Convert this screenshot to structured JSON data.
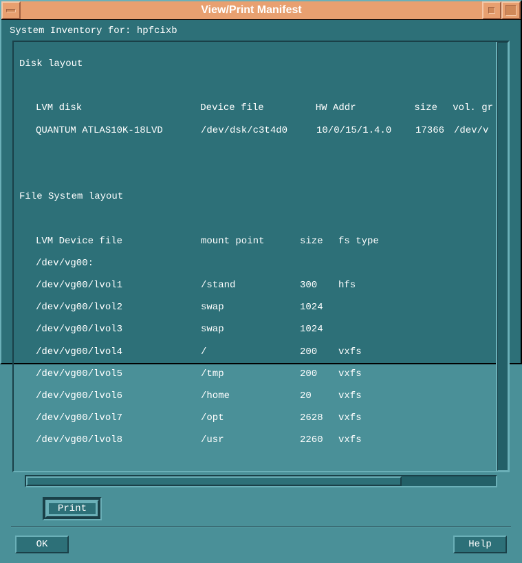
{
  "window": {
    "title": "View/Print Manifest"
  },
  "header": {
    "label": "System Inventory for: hpfcixb"
  },
  "disk_layout": {
    "title": "Disk layout",
    "head": {
      "disk": "LVM disk",
      "device": "Device file",
      "hw": "HW Addr",
      "size": "size",
      "vol": "vol. gr"
    },
    "rows": [
      {
        "disk": "QUANTUM ATLAS10K-18LVD",
        "device": "/dev/dsk/c3t4d0",
        "hw": "10/0/15/1.4.0",
        "size": "17366",
        "vol": "/dev/v"
      }
    ]
  },
  "fs_layout": {
    "title": "File System layout",
    "head": {
      "dev": "LVM Device file",
      "mnt": "mount point",
      "size": "size",
      "fs": "fs type"
    },
    "group": "/dev/vg00:",
    "rows": [
      {
        "dev": "/dev/vg00/lvol1",
        "mnt": "/stand",
        "size": "300",
        "fs": "hfs"
      },
      {
        "dev": "/dev/vg00/lvol2",
        "mnt": "swap",
        "size": "1024",
        "fs": ""
      },
      {
        "dev": "/dev/vg00/lvol3",
        "mnt": "swap",
        "size": "1024",
        "fs": ""
      },
      {
        "dev": "/dev/vg00/lvol4",
        "mnt": "/",
        "size": "200",
        "fs": "vxfs"
      },
      {
        "dev": "/dev/vg00/lvol5",
        "mnt": "/tmp",
        "size": "200",
        "fs": "vxfs"
      },
      {
        "dev": "/dev/vg00/lvol6",
        "mnt": "/home",
        "size": "20",
        "fs": "vxfs"
      },
      {
        "dev": "/dev/vg00/lvol7",
        "mnt": "/opt",
        "size": "2628",
        "fs": "vxfs"
      },
      {
        "dev": "/dev/vg00/lvol8",
        "mnt": "/usr",
        "size": "2260",
        "fs": "vxfs"
      }
    ]
  },
  "buttons": {
    "print": "Print",
    "ok": "OK",
    "help": "Help"
  }
}
